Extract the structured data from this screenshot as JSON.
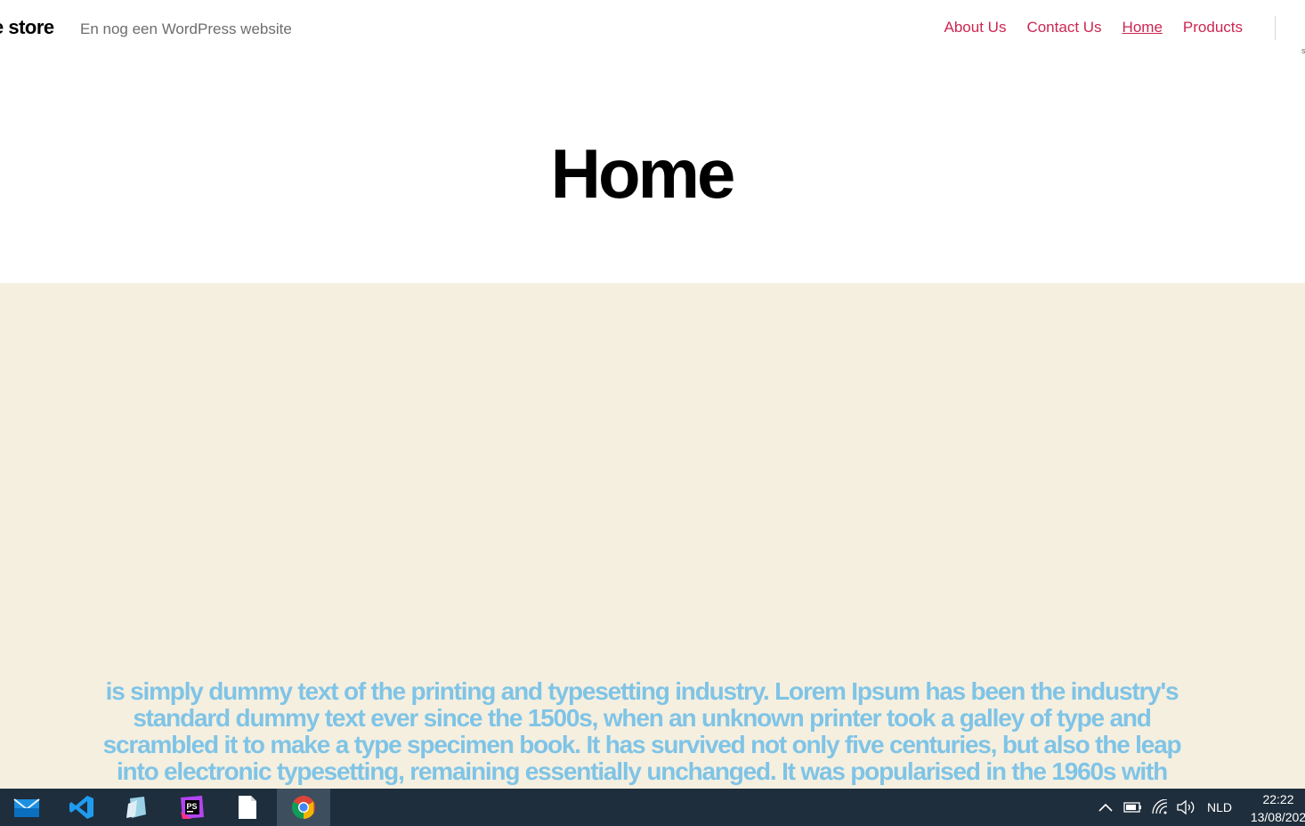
{
  "header": {
    "site_title": "e store",
    "site_description": "En nog een WordPress website"
  },
  "nav": {
    "items": [
      {
        "label": "About Us"
      },
      {
        "label": "Contact Us"
      },
      {
        "label": "Home",
        "current": true
      },
      {
        "label": "Products"
      }
    ]
  },
  "page": {
    "title": "Home"
  },
  "cover": {
    "background_color": "#f5efe0",
    "text_color": "#7fc4e6",
    "text": "is simply dummy text of the printing and typesetting industry. Lorem Ipsum has been the industry's standard dummy text ever since the 1500s, when an unknown printer took a galley of type and scrambled it to make a type specimen book. It has survived not only five centuries, but also the leap into electronic typesetting, remaining essentially unchanged. It was popularised in the 1960s with"
  },
  "colors": {
    "accent": "#cd2653",
    "taskbar": "#1f2e3c"
  },
  "taskbar": {
    "apps": [
      {
        "name": "mail-icon"
      },
      {
        "name": "vscode-icon"
      },
      {
        "name": "notepad-icon"
      },
      {
        "name": "phpstorm-icon"
      },
      {
        "name": "file-icon"
      },
      {
        "name": "chrome-icon",
        "active": true
      }
    ],
    "language": "NLD",
    "time": "22:22",
    "date": "13/08/202"
  }
}
